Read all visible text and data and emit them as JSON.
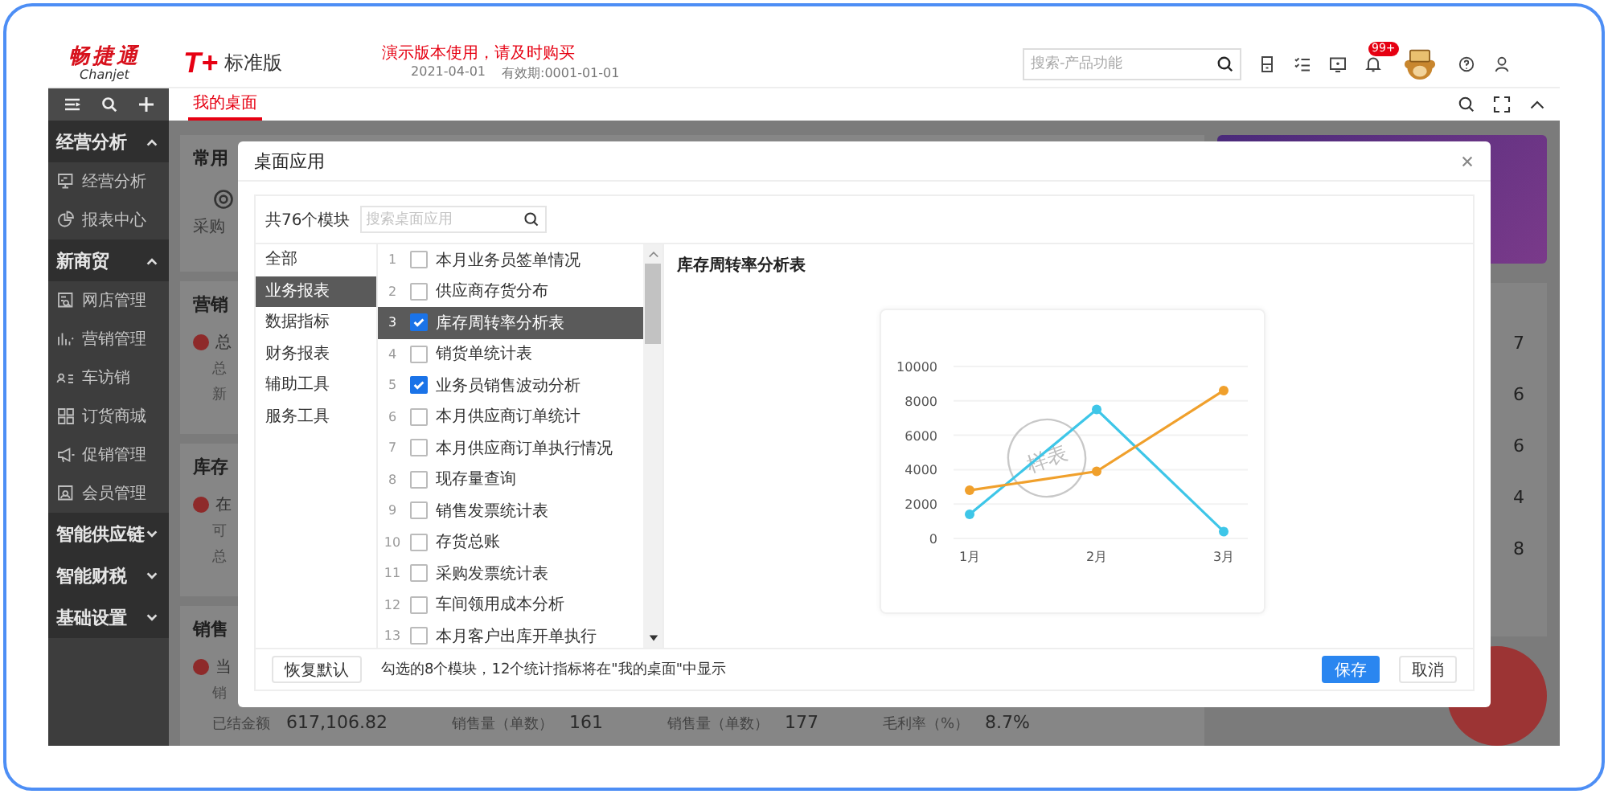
{
  "header": {
    "logo_text": "畅捷通",
    "logo_sub": "Chanjet",
    "product_mark": "T+",
    "edition": "标准版",
    "notice": "演示版本使用，请及时购买",
    "login_date": "2021-04-01",
    "valid_until": "有效期:0001-01-01",
    "search": {
      "placeholder": "搜索-产品功能"
    },
    "notification_badge": "99+"
  },
  "tabs": [
    {
      "label": "我的桌面",
      "selected": true
    }
  ],
  "sidebar": {
    "groups": [
      {
        "label": "经营分析",
        "expanded": true,
        "items": [
          {
            "label": "经营分析",
            "kind": "monitor"
          },
          {
            "label": "报表中心",
            "kind": "pie"
          }
        ]
      },
      {
        "label": "新商贸",
        "expanded": true,
        "items": [
          {
            "label": "网店管理",
            "kind": "shop"
          },
          {
            "label": "营销管理",
            "kind": "bars"
          },
          {
            "label": "车访销",
            "kind": "people"
          },
          {
            "label": "订货商城",
            "kind": "grid"
          },
          {
            "label": "促销管理",
            "kind": "megaphone"
          },
          {
            "label": "会员管理",
            "kind": "member"
          }
        ]
      },
      {
        "label": "智能供应链",
        "expanded": false
      },
      {
        "label": "智能财税",
        "expanded": false
      },
      {
        "label": "基础设置",
        "expanded": false
      }
    ]
  },
  "dashboard": {
    "cards": [
      {
        "title": "常用",
        "kind": "shortcuts",
        "lines": [
          "采购"
        ]
      },
      {
        "title": "营销",
        "kind": "summary",
        "lines": [
          "总",
          "总",
          "新"
        ]
      },
      {
        "title": "库存",
        "kind": "summary",
        "lines": [
          "在",
          "可",
          "总"
        ]
      },
      {
        "title": "销售",
        "kind": "summary",
        "lines": [
          "当",
          "销"
        ],
        "stats": [
          {
            "label": "已结金额",
            "value": "617,106.82"
          },
          {
            "label": "销售量（单数）",
            "value": "161"
          },
          {
            "label": "销售量（单数）",
            "value": "177"
          },
          {
            "label": "毛利率（%）",
            "value": "8.7%"
          }
        ]
      }
    ],
    "side_values": [
      "7",
      "6",
      "6",
      "4",
      "8"
    ]
  },
  "modal": {
    "title": "桌面应用",
    "module_count": "共76个模块",
    "search": {
      "placeholder": "搜索桌面应用"
    },
    "categories": [
      {
        "label": "全部",
        "selected": false
      },
      {
        "label": "业务报表",
        "selected": true
      },
      {
        "label": "数据指标",
        "selected": false
      },
      {
        "label": "财务报表",
        "selected": false
      },
      {
        "label": "辅助工具",
        "selected": false
      },
      {
        "label": "服务工具",
        "selected": false
      }
    ],
    "modules": [
      {
        "number": "1",
        "label": "本月业务员签单情况",
        "checked": false,
        "selected": false
      },
      {
        "number": "2",
        "label": "供应商存货分布",
        "checked": false,
        "selected": false
      },
      {
        "number": "3",
        "label": "库存周转率分析表",
        "checked": true,
        "selected": true
      },
      {
        "number": "4",
        "label": "销货单统计表",
        "checked": false,
        "selected": false
      },
      {
        "number": "5",
        "label": "业务员销售波动分析",
        "checked": true,
        "selected": false
      },
      {
        "number": "6",
        "label": "本月供应商订单统计",
        "checked": false,
        "selected": false
      },
      {
        "number": "7",
        "label": "本月供应商订单执行情况",
        "checked": false,
        "selected": false
      },
      {
        "number": "8",
        "label": "现存量查询",
        "checked": false,
        "selected": false
      },
      {
        "number": "9",
        "label": "销售发票统计表",
        "checked": false,
        "selected": false
      },
      {
        "number": "10",
        "label": "存货总账",
        "checked": false,
        "selected": false
      },
      {
        "number": "11",
        "label": "采购发票统计表",
        "checked": false,
        "selected": false
      },
      {
        "number": "12",
        "label": "车间领用成本分析",
        "checked": false,
        "selected": false
      },
      {
        "number": "13",
        "label": "本月客户出库开单执行",
        "checked": false,
        "selected": false
      }
    ],
    "preview": {
      "title": "库存周转率分析表",
      "stamp": "样表",
      "chart_data": {
        "type": "line",
        "categories": [
          "1月",
          "2月",
          "3月"
        ],
        "series": [
          {
            "color": "#3ec6e8",
            "marker": "circle",
            "values": [
              1400,
              7500,
              400
            ]
          },
          {
            "color": "#f0a02c",
            "marker": "circle",
            "values": [
              2800,
              3900,
              8600
            ]
          }
        ],
        "grid": true,
        "ylim": [
          0,
          10000
        ],
        "yticks": [
          0,
          2000,
          4000,
          6000,
          8000,
          10000
        ]
      }
    },
    "footer": {
      "reset": "恢复默认",
      "hint": "勾选的8个模块，12个统计指标将在\"我的桌面\"中显示",
      "save": "保存",
      "cancel": "取消"
    }
  }
}
